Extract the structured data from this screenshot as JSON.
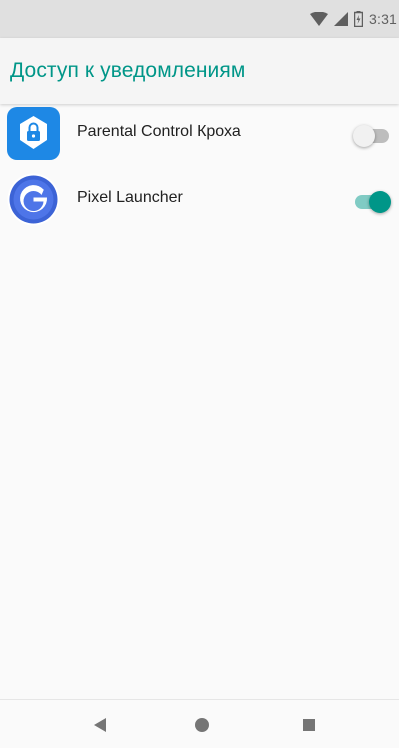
{
  "status_bar": {
    "time": "3:31",
    "icons": [
      "wifi-icon",
      "signal-icon",
      "battery-icon"
    ]
  },
  "app_bar": {
    "title": "Доступ к уведомлениям"
  },
  "apps": [
    {
      "label": "Parental Control Кроха",
      "icon": "parental-control-icon",
      "enabled": false
    },
    {
      "label": "Pixel Launcher",
      "icon": "pixel-launcher-icon",
      "enabled": true
    }
  ],
  "nav_bar": {
    "buttons": [
      "back-icon",
      "home-icon",
      "recents-icon"
    ]
  },
  "colors": {
    "accent": "#009688",
    "accent_light": "#80cbc4",
    "status_bar": "#e0e0e0",
    "app_bar": "#f5f5f5",
    "background": "#fafafa",
    "text": "#212121"
  }
}
